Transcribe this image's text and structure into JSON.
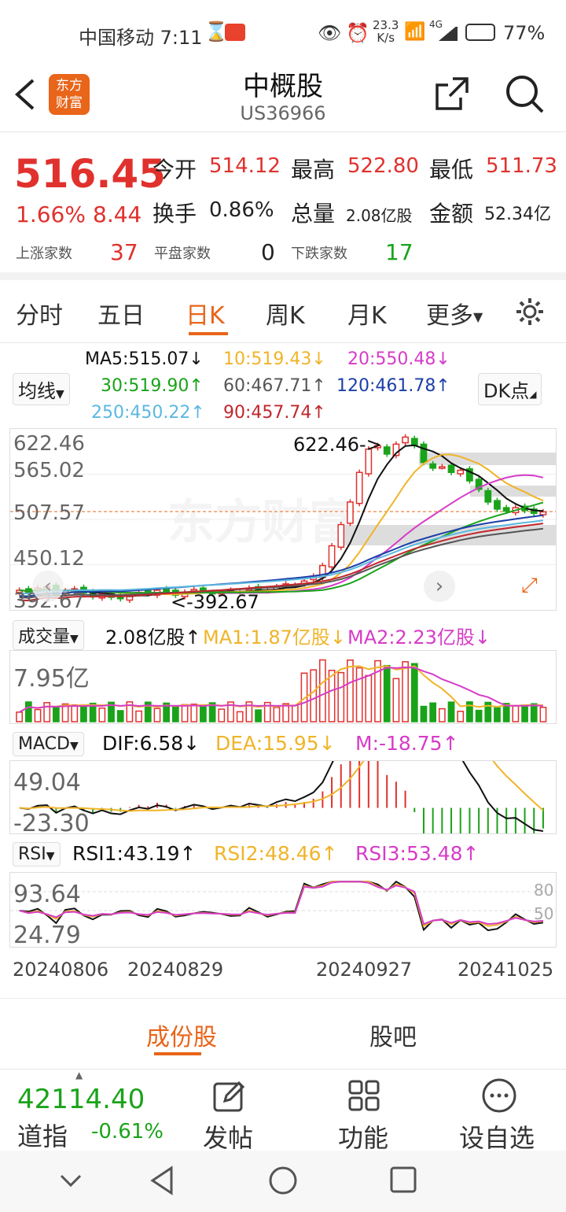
{
  "status": {
    "carrier_time": "中国移动 7:11",
    "speed": "23.3",
    "speed_unit": "K/s",
    "net": "4G",
    "battery": "77%"
  },
  "header": {
    "title": "中概股",
    "code": "US36966",
    "logo_top": "东方",
    "logo_bottom": "财富"
  },
  "quote": {
    "price": "516.45",
    "pct": "1.66%",
    "chg": "8.44",
    "open_label": "今开",
    "open": "514.12",
    "high_label": "最高",
    "high": "522.80",
    "low_label": "最低",
    "low": "511.73",
    "turnover_label": "换手",
    "turnover": "0.86%",
    "vol_label": "总量",
    "vol": "2.08亿股",
    "amt_label": "金额",
    "amt": "52.34亿",
    "up_label": "上涨家数",
    "up": "37",
    "flat_label": "平盘家数",
    "flat": "0",
    "down_label": "下跌家数",
    "down": "17"
  },
  "tabs": [
    "分时",
    "五日",
    "日K",
    "周K",
    "月K",
    "更多"
  ],
  "ma": {
    "selector": "均线",
    "dk": "DK点",
    "ma5": "MA5:515.07↓",
    "ma10": "10:519.43↓",
    "ma20": "20:550.48↓",
    "ma30": "30:519.90↑",
    "ma60": "60:467.71↑",
    "ma120": "120:461.78↑",
    "ma250": "250:450.22↑",
    "ma90": "90:457.74↑"
  },
  "colors": {
    "up": "#e0312d",
    "down": "#1aa31a",
    "ma5": "#111111",
    "ma10": "#f0b429",
    "ma20": "#d63cc8",
    "ma30": "#1aa31a",
    "accent": "#e8651a"
  },
  "vol": {
    "selector": "成交量",
    "value": "2.08亿股↑",
    "ma1": "MA1:1.87亿股↓",
    "ma2": "MA2:2.23亿股↓",
    "max": "7.95亿"
  },
  "macd": {
    "selector": "MACD",
    "dif": "DIF:6.58↓",
    "dea": "DEA:15.95↓",
    "m": "M:-18.75↑",
    "max": "49.04",
    "min": "-23.30"
  },
  "rsi": {
    "selector": "RSI",
    "rsi1": "RSI1:43.19↑",
    "rsi2": "RSI2:48.46↑",
    "rsi3": "RSI3:53.48↑",
    "max": "93.64",
    "min": "24.79",
    "l80": "80",
    "l50": "50"
  },
  "dates": [
    "20240806",
    "20240829",
    "20240927",
    "20241025"
  ],
  "bottom_tabs": [
    "成份股",
    "股吧"
  ],
  "bottom": {
    "index_value": "42114.40",
    "index_name": "道指",
    "index_pct": "-0.61%",
    "post": "发帖",
    "func": "功能",
    "watch": "设自选"
  },
  "chart_data": {
    "type": "candlestick",
    "price_axis": [
      "622.46",
      "565.02",
      "507.57",
      "450.12",
      "392.67"
    ],
    "high_label": "622.46->",
    "low_label": "<-392.67",
    "closes": [
      405,
      402,
      408,
      410,
      398,
      404,
      407,
      401,
      396,
      400,
      395,
      393,
      398,
      402,
      400,
      405,
      403,
      398,
      402,
      406,
      404,
      400,
      402,
      405,
      403,
      408,
      406,
      404,
      410,
      414,
      412,
      418,
      425,
      440,
      468,
      498,
      530,
      572,
      605,
      610,
      598,
      612,
      622,
      610,
      586,
      578,
      580,
      572,
      575,
      560,
      548,
      530,
      520,
      517,
      522,
      518,
      514,
      516
    ]
  }
}
